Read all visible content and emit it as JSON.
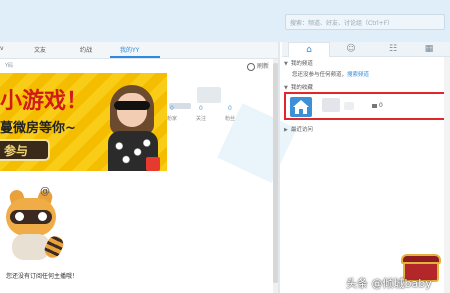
{
  "header": {
    "search_placeholder": "搜索：频道、好友、讨论组（Ctrl+F）"
  },
  "tabs": [
    {
      "label": "v"
    },
    {
      "label": "文友"
    },
    {
      "label": "约战"
    },
    {
      "label": "我的YY"
    }
  ],
  "subrow": {
    "left_label": "Y码",
    "refresh_label": "刷新"
  },
  "banner": {
    "headline": "小游戏！",
    "subline": "蔓微房等你~",
    "button_label": "参与"
  },
  "profile": {
    "stats": [
      {
        "value": "0",
        "label": "粉家"
      },
      {
        "value": "0",
        "label": "关注"
      },
      {
        "value": "0",
        "label": "粉丝"
      }
    ]
  },
  "empty_state": {
    "message": "您还没有订阅任何主播哦！"
  },
  "right_panel": {
    "tabs": [
      {
        "icon": "home-icon"
      },
      {
        "icon": "user-icon"
      },
      {
        "icon": "users-icon"
      },
      {
        "icon": "apps-icon"
      }
    ],
    "sections": {
      "my_channels": "我的频道",
      "no_channels_text": "您还没参与任何频道，",
      "search_link": "搜索频道",
      "my_favorites": "我的收藏",
      "recent": "最近访问"
    },
    "favorite": {
      "count": "0"
    }
  },
  "watermark": {
    "text": "头条 @倾城baby"
  },
  "colors": {
    "accent": "#2d8ae0",
    "highlight_border": "#e1262c",
    "header_bg": "#dfeef8"
  }
}
